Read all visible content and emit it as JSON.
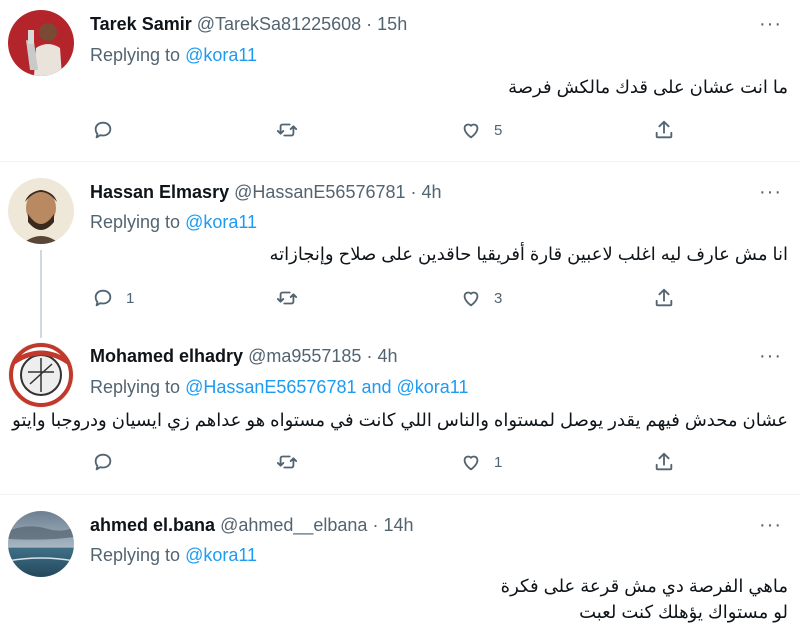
{
  "replies": [
    {
      "name": "Tarek Samir",
      "handle": "@TarekSa81225608",
      "time": "15h",
      "replying_prefix": "Replying to",
      "replying_to": "@kora11",
      "text": "ما انت عشان على قدك مالكش فرصة",
      "text_line2": "",
      "reply_count": "",
      "retweet_count": "",
      "like_count": "5"
    },
    {
      "name": "Hassan Elmasry",
      "handle": "@HassanE56576781",
      "time": "4h",
      "replying_prefix": "Replying to",
      "replying_to": "@kora11",
      "text": "انا مش عارف ليه اغلب لاعبين قارة أفريقيا حاقدين على صلاح وإنجازاته",
      "text_line2": "",
      "reply_count": "1",
      "retweet_count": "",
      "like_count": "3"
    },
    {
      "name": "Mohamed elhadry",
      "handle": "@ma9557185",
      "time": "4h",
      "replying_prefix": "Replying to",
      "replying_to": "@HassanE56576781 and @kora11",
      "text": "عشان محدش فيهم يقدر يوصل لمستواه والناس اللي كانت في مستواه هو عداهم زي ايسيان ودروجبا وايتو",
      "text_line2": "",
      "reply_count": "",
      "retweet_count": "",
      "like_count": "1"
    },
    {
      "name": "ahmed el.bana",
      "handle": "@ahmed__elbana",
      "time": "14h",
      "replying_prefix": "Replying to",
      "replying_to": "@kora11",
      "text": "ماهي الفرصة دي مش قرعة على فكرة",
      "text_line2": "لو مستواك يؤهلك كنت لعبت",
      "reply_count": "",
      "retweet_count": "",
      "like_count": ""
    }
  ],
  "separator": "·",
  "icons": [
    "more-icon",
    "reply-icon",
    "retweet-icon",
    "like-icon",
    "share-icon"
  ],
  "colors": {
    "accent": "#1d9bf0",
    "muted": "#536471",
    "text": "#0f1419"
  }
}
